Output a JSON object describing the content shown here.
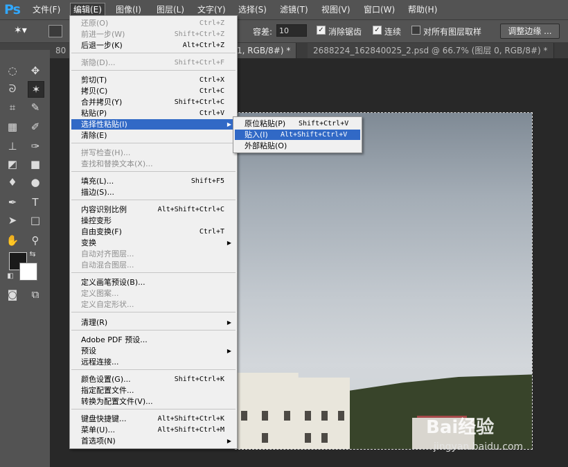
{
  "app": {
    "logo": "Ps"
  },
  "menubar": {
    "items": [
      {
        "label": "文件(F)"
      },
      {
        "label": "编辑(E)"
      },
      {
        "label": "图像(I)"
      },
      {
        "label": "图层(L)"
      },
      {
        "label": "文字(Y)"
      },
      {
        "label": "选择(S)"
      },
      {
        "label": "滤镜(T)"
      },
      {
        "label": "视图(V)"
      },
      {
        "label": "窗口(W)"
      },
      {
        "label": "帮助(H)"
      }
    ]
  },
  "options": {
    "tolerance_label": "容差:",
    "tolerance_value": "10",
    "antialias_label": "消除锯齿",
    "contiguous_label": "连续",
    "sample_all_label": "对所有图层取样",
    "refine_edge_label": "调整边缘 ..."
  },
  "tabs": [
    {
      "label": "80"
    },
    {
      "label": "1, RGB/8#) *"
    },
    {
      "label": "2688224_162840025_2.psd @ 66.7% (图层 0, RGB/8#) *"
    }
  ],
  "edit_menu": {
    "items": [
      {
        "label": "还原(O)",
        "shortcut": "Ctrl+Z"
      },
      {
        "label": "前进一步(W)",
        "shortcut": "Shift+Ctrl+Z"
      },
      {
        "label": "后退一步(K)",
        "shortcut": "Alt+Ctrl+Z"
      },
      {
        "label": "渐隐(D)...",
        "shortcut": "Shift+Ctrl+F"
      },
      {
        "label": "剪切(T)",
        "shortcut": "Ctrl+X"
      },
      {
        "label": "拷贝(C)",
        "shortcut": "Ctrl+C"
      },
      {
        "label": "合并拷贝(Y)",
        "shortcut": "Shift+Ctrl+C"
      },
      {
        "label": "粘贴(P)",
        "shortcut": "Ctrl+V"
      },
      {
        "label": "选择性粘贴(I)",
        "shortcut": ""
      },
      {
        "label": "清除(E)",
        "shortcut": ""
      },
      {
        "label": "拼写检查(H)...",
        "shortcut": ""
      },
      {
        "label": "查找和替换文本(X)...",
        "shortcut": ""
      },
      {
        "label": "填充(L)...",
        "shortcut": "Shift+F5"
      },
      {
        "label": "描边(S)...",
        "shortcut": ""
      },
      {
        "label": "内容识别比例",
        "shortcut": "Alt+Shift+Ctrl+C"
      },
      {
        "label": "操控变形",
        "shortcut": ""
      },
      {
        "label": "自由变换(F)",
        "shortcut": "Ctrl+T"
      },
      {
        "label": "变换",
        "shortcut": ""
      },
      {
        "label": "自动对齐图层...",
        "shortcut": ""
      },
      {
        "label": "自动混合图层...",
        "shortcut": ""
      },
      {
        "label": "定义画笔预设(B)...",
        "shortcut": ""
      },
      {
        "label": "定义图案...",
        "shortcut": ""
      },
      {
        "label": "定义自定形状...",
        "shortcut": ""
      },
      {
        "label": "清理(R)",
        "shortcut": ""
      },
      {
        "label": "Adobe PDF 预设...",
        "shortcut": ""
      },
      {
        "label": "预设",
        "shortcut": ""
      },
      {
        "label": "远程连接...",
        "shortcut": ""
      },
      {
        "label": "颜色设置(G)...",
        "shortcut": "Shift+Ctrl+K"
      },
      {
        "label": "指定配置文件...",
        "shortcut": ""
      },
      {
        "label": "转换为配置文件(V)...",
        "shortcut": ""
      },
      {
        "label": "键盘快捷键...",
        "shortcut": "Alt+Shift+Ctrl+K"
      },
      {
        "label": "菜单(U)...",
        "shortcut": "Alt+Shift+Ctrl+M"
      },
      {
        "label": "首选项(N)",
        "shortcut": ""
      }
    ]
  },
  "paste_special_menu": {
    "items": [
      {
        "label": "原位粘贴(P)",
        "shortcut": "Shift+Ctrl+V"
      },
      {
        "label": "贴入(I)",
        "shortcut": "Alt+Shift+Ctrl+V"
      },
      {
        "label": "外部粘贴(O)",
        "shortcut": ""
      }
    ]
  },
  "watermark": {
    "brand": "Bai经验",
    "url": "jingyan.baidu.com"
  },
  "colors": {
    "menu_highlight": "#3169c6",
    "accent": "#31a8ff"
  }
}
